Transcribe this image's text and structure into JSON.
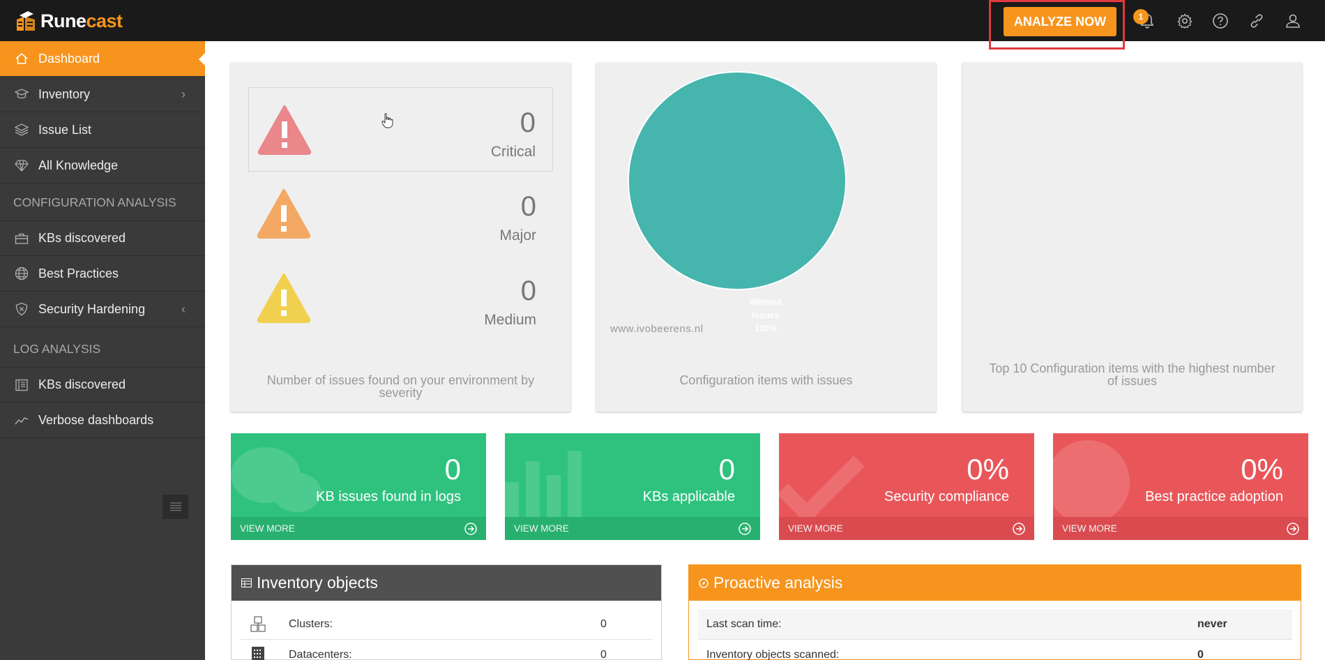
{
  "app": {
    "logo_prefix": "Rune",
    "logo_suffix": "cast",
    "analyze_button": "ANALYZE NOW",
    "notification_count": "1",
    "brand_color": "#f7941d"
  },
  "sidebar": {
    "items": [
      {
        "label": "Dashboard",
        "icon": "home-icon"
      },
      {
        "label": "Inventory",
        "icon": "inventory-icon"
      },
      {
        "label": "Issue List",
        "icon": "layers-icon"
      },
      {
        "label": "All Knowledge",
        "icon": "diamond-icon"
      },
      {
        "label": "KBs discovered",
        "icon": "briefcase-icon"
      },
      {
        "label": "Best Practices",
        "icon": "globe-icon"
      },
      {
        "label": "Security Hardening",
        "icon": "shield-icon"
      },
      {
        "label": "KBs discovered",
        "icon": "book-icon"
      },
      {
        "label": "Verbose dashboards",
        "icon": "chart-line-icon"
      }
    ],
    "section_config": "CONFIGURATION ANALYSIS",
    "section_log": "LOG ANALYSIS"
  },
  "severity": {
    "critical": {
      "count": "0",
      "label": "Critical",
      "color": "#e9878a"
    },
    "major": {
      "count": "0",
      "label": "Major",
      "color": "#f3a863"
    },
    "medium": {
      "count": "0",
      "label": "Medium",
      "color": "#f1d04f"
    },
    "caption": "Number of issues found on your environment by severity"
  },
  "config_items": {
    "caption": "Configuration items with issues",
    "pie_label_line1": "Without",
    "pie_label_line2": "Issues",
    "pie_label_line3": "100%",
    "pie_color": "#45b5ae",
    "watermark": "www.ivobeerens.nl"
  },
  "top10": {
    "caption": "Top 10 Configuration items with the highest number of issues"
  },
  "chart_data": {
    "type": "pie",
    "categories": [
      "Without Issues"
    ],
    "values": [
      100
    ],
    "title": "Configuration items with issues"
  },
  "tiles": [
    {
      "value": "0",
      "label": "KB issues found in logs",
      "more": "VIEW MORE"
    },
    {
      "value": "0",
      "label": "KBs applicable",
      "more": "VIEW MORE"
    },
    {
      "value": "0%",
      "label": "Security compliance",
      "more": "VIEW MORE"
    },
    {
      "value": "0%",
      "label": "Best practice adoption",
      "more": "VIEW MORE"
    }
  ],
  "inventory": {
    "title": "Inventory objects",
    "rows": [
      {
        "label": "Clusters:",
        "value": "0"
      },
      {
        "label": "Datacenters:",
        "value": "0"
      }
    ]
  },
  "proactive": {
    "title": "Proactive analysis",
    "rows": [
      {
        "label": "Last scan time:",
        "value": "never"
      },
      {
        "label": "Inventory objects scanned:",
        "value": "0"
      }
    ]
  }
}
